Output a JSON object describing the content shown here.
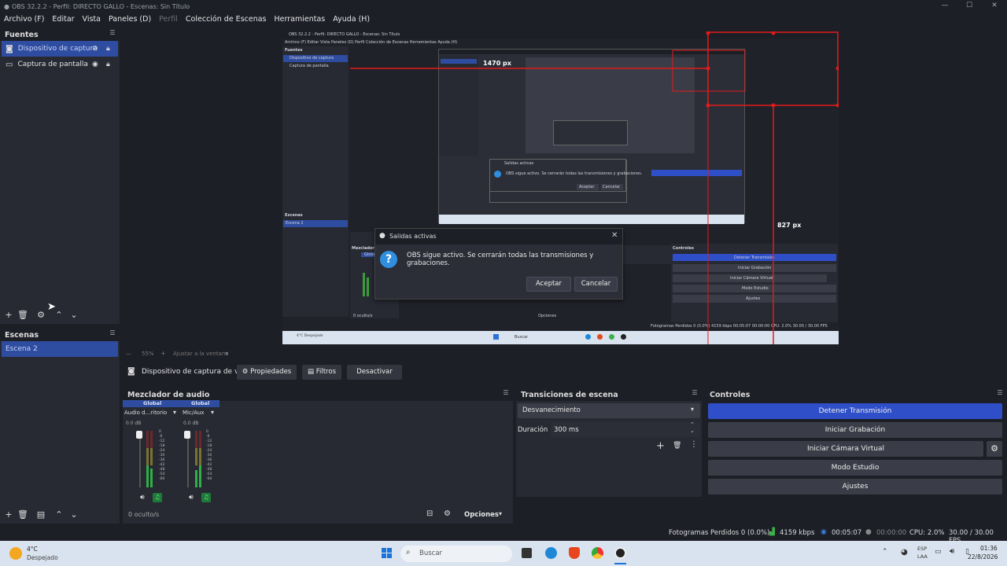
{
  "window": {
    "title": "OBS 32.2.2 - Perfil: DIRECTO GALLO - Escenas: Sin Título"
  },
  "menu": [
    "Archivo (F)",
    "Editar",
    "Vista",
    "Paneles (D)",
    "Perfil",
    "Colección de Escenas",
    "Herramientas",
    "Ayuda (H)"
  ],
  "sources": {
    "title": "Fuentes",
    "items": [
      {
        "label": "Dispositivo de captura",
        "selected": true
      },
      {
        "label": "Captura de pantalla",
        "selected": false
      }
    ]
  },
  "scenes": {
    "title": "Escenas",
    "items": [
      {
        "label": "Escena 2",
        "selected": true
      }
    ]
  },
  "preview": {
    "inner_title": "OBS 32.2.2 - Perfil: DIRECTO GALLO - Escenas: Sin Título",
    "inner_menu": "Archivo (F)   Editar   Vista   Paneles (D)   Perfil   Colección de Escenas   Herramientas   Ayuda (H)",
    "inner_sources_title": "Fuentes",
    "inner_source_1": "Dispositivo de captura",
    "inner_source_2": "Captura de pantalla",
    "inner_scenes_title": "Escenas",
    "inner_scene": "Escena 2",
    "measure_w": "1470 px",
    "measure_h": "827 px",
    "inner_mixer": "Mezclador d",
    "inner_global": "Global",
    "inner_controls_title": "Controles",
    "inner_controls": [
      "Detener Transmisión",
      "Iniciar Grabación",
      "Iniciar Cámara Virtual",
      "Modo Estudio",
      "Ajustes"
    ],
    "inner_status": "Fotogramas Perdidos 0 (0.0%)   4159 kbps   00:05:07   00:00:00   CPU: 2.0%   30.00 / 30.00 FPS",
    "inner_taskbar_search": "Buscar",
    "inner_weather": "4°C Despejado",
    "inner_hidden": "0 oculto/s",
    "inner_options": "Opciones",
    "inner_dialog_title": "Salidas activas",
    "inner_dialog_msg": "OBS sigue activo. Se cerrarán todas las transmisiones y grabaciones.",
    "inner_dialog_ok": "Aceptar",
    "inner_dialog_cancel": "Cancelar"
  },
  "dialog": {
    "title": "Salidas activas",
    "message": "OBS sigue activo. Se cerrarán todas las transmisiones y grabaciones.",
    "ok": "Aceptar",
    "cancel": "Cancelar"
  },
  "zoom": {
    "value": "55%",
    "fit": "Ajustar a la ventana"
  },
  "source_toolbar": {
    "source": "Dispositivo de captura de v",
    "properties": "Propiedades",
    "filters": "Filtros",
    "deactivate": "Desactivar"
  },
  "mixer": {
    "title": "Mezclador de audio",
    "hidden": "0 oculto/s",
    "options": "Opciones",
    "channels": [
      {
        "global": "Global",
        "name": "Audio d...ritorio",
        "db": "0.0 dB"
      },
      {
        "global": "Global",
        "name": "Mic/Aux",
        "db": "0.0 dB"
      }
    ],
    "scale": [
      "0",
      "-6",
      "-12",
      "-18",
      "-24",
      "-30",
      "-36",
      "-42",
      "-48",
      "-54",
      "-60"
    ]
  },
  "transitions": {
    "title": "Transiciones de escena",
    "selected": "Desvanecimiento",
    "duration_label": "Duración",
    "duration_value": "300 ms"
  },
  "controls": {
    "title": "Controles",
    "buttons": [
      "Detener Transmisión",
      "Iniciar Grabación",
      "Iniciar Cámara Virtual",
      "Modo Estudio",
      "Ajustes"
    ],
    "active_color": "#2f4fc9"
  },
  "status": {
    "dropped": "Fotogramas Perdidos 0 (0.0%)",
    "bitrate": "4159 kbps",
    "stream_time": "00:05:07",
    "rec_time": "00:00:00",
    "cpu": "CPU: 2.0%",
    "fps": "30.00 / 30.00 FPS"
  },
  "taskbar": {
    "temp": "4°C",
    "weather": "Despejado",
    "search": "Buscar",
    "lang1": "ESP",
    "lang2": "LAA",
    "time": "01:36",
    "date": "22/8/2026"
  }
}
